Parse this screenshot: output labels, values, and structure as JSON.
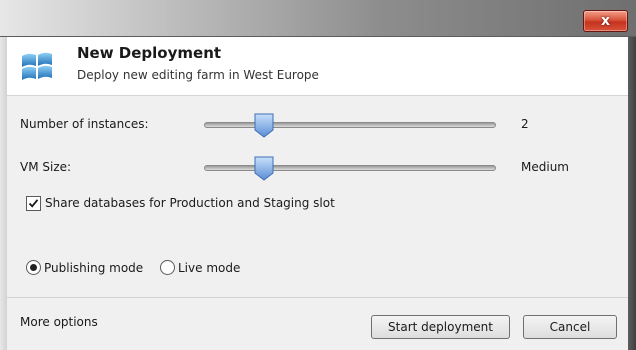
{
  "window": {
    "close_label": "x"
  },
  "header": {
    "title": "New Deployment",
    "subtitle": "Deploy new editing farm in West Europe",
    "icon": "windows-logo-icon"
  },
  "form": {
    "instances": {
      "label": "Number of instances:",
      "value": "2",
      "slider_level": 0.2
    },
    "vm_size": {
      "label": "VM Size:",
      "value": "Medium",
      "slider_level": 0.2
    },
    "share_databases": {
      "label": "Share databases for Production and Staging slot",
      "checked": true
    },
    "mode": {
      "options": [
        {
          "label": "Publishing mode",
          "selected": true
        },
        {
          "label": "Live mode",
          "selected": false
        }
      ]
    }
  },
  "footer": {
    "more_options": "More options",
    "start_button": "Start deployment",
    "cancel_button": "Cancel"
  },
  "colors": {
    "close_button": "#c4331e",
    "slider_thumb": "#5b8ed6",
    "dialog_body": "#f0f0f0"
  }
}
